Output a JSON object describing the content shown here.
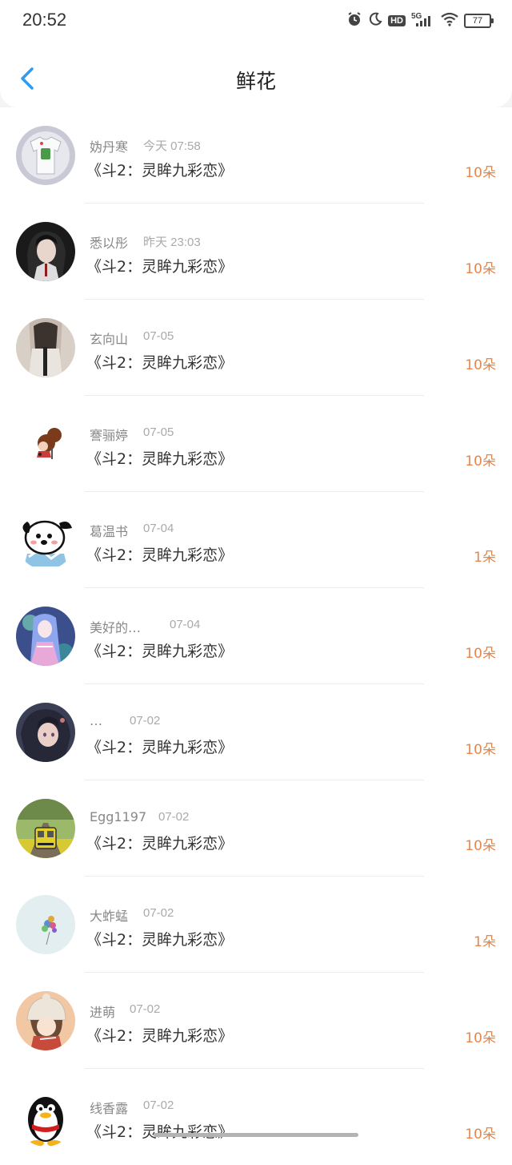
{
  "status_bar": {
    "time": "20:52",
    "network": "5G",
    "hd": "HD",
    "battery": "77",
    "icons": [
      "alarm-icon",
      "moon-icon",
      "hd-icon",
      "signal-icon",
      "wifi-icon",
      "battery-icon"
    ]
  },
  "nav": {
    "title": "鲜花",
    "back_icon": "chevron-left-icon"
  },
  "colors": {
    "accent_blue": "#2f9bf0",
    "amount_orange": "#e5864a",
    "name_gray": "#888888",
    "time_gray": "#aaaaaa",
    "book_text": "#333333"
  },
  "rows": [
    {
      "name": "妫丹寒",
      "time": "今天 07:58",
      "book": "《斗2：灵眸九彩恋》",
      "amount": "10朵",
      "avatar": "avatar-tshirt"
    },
    {
      "name": "悉以彤",
      "time": "昨天 23:03",
      "book": "《斗2：灵眸九彩恋》",
      "amount": "10朵",
      "avatar": "avatar-dark-anime"
    },
    {
      "name": "玄向山",
      "time": "07-05",
      "book": "《斗2：灵眸九彩恋》",
      "amount": "10朵",
      "avatar": "avatar-figure"
    },
    {
      "name": "謇骊婷",
      "time": "07-05",
      "book": "《斗2：灵眸九彩恋》",
      "amount": "10朵",
      "avatar": "avatar-chibi"
    },
    {
      "name": "葛温书",
      "time": "07-04",
      "book": "《斗2：灵眸九彩恋》",
      "amount": "1朵",
      "avatar": "avatar-dog-cartoon"
    },
    {
      "name": "美好的…",
      "time": "07-04",
      "book": "《斗2：灵眸九彩恋》",
      "amount": "10朵",
      "avatar": "avatar-anime-girl"
    },
    {
      "name": "…",
      "time": "07-02",
      "book": "《斗2：灵眸九彩恋》",
      "amount": "10朵",
      "avatar": "avatar-anime-dark"
    },
    {
      "name": "Egg1197",
      "time": "07-02",
      "book": "《斗2：灵眸九彩恋》",
      "amount": "10朵",
      "avatar": "avatar-train"
    },
    {
      "name": "大蚱蜢",
      "time": "07-02",
      "book": "《斗2：灵眸九彩恋》",
      "amount": "1朵",
      "avatar": "avatar-balloons"
    },
    {
      "name": "进萌",
      "time": "07-02",
      "book": "《斗2：灵眸九彩恋》",
      "amount": "10朵",
      "avatar": "avatar-girl-hat"
    },
    {
      "name": "线香露",
      "time": "07-02",
      "book": "《斗2：灵眸九彩恋》",
      "amount": "10朵",
      "avatar": "avatar-qq-penguin"
    }
  ]
}
